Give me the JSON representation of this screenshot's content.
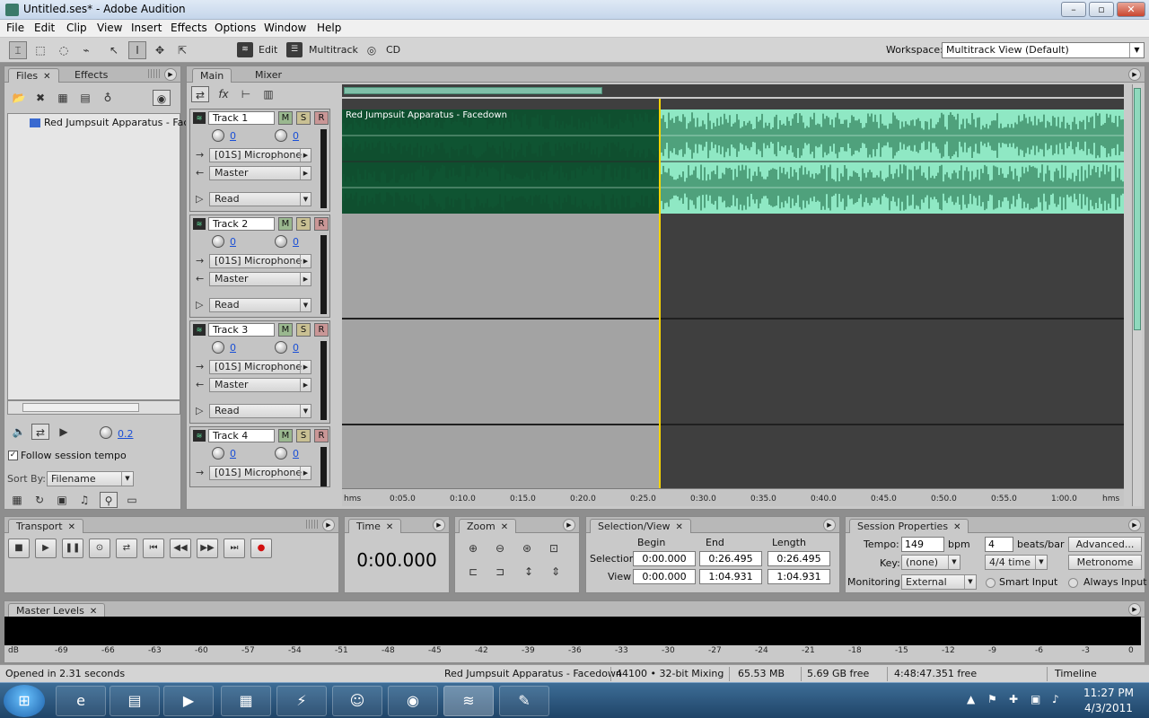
{
  "window": {
    "title": "Untitled.ses* - Adobe Audition",
    "buttons": {
      "minimize": "–",
      "maximize": "▫",
      "close": "✕"
    }
  },
  "menu": [
    "File",
    "Edit",
    "Clip",
    "View",
    "Insert",
    "Effects",
    "Options",
    "Window",
    "Help"
  ],
  "toolbar": {
    "edit_label": "Edit",
    "multitrack_label": "Multitrack",
    "cd_label": "CD",
    "workspace_label": "Workspace:",
    "workspace_value": "Multitrack View (Default)"
  },
  "files_panel": {
    "tabs": [
      "Files",
      "Effects"
    ],
    "items": [
      "Red Jumpsuit Apparatus - Faced"
    ],
    "volume_value": "0.2",
    "follow_tempo_label": "Follow session tempo",
    "sort_by_label": "Sort By:",
    "sort_by_value": "Filename"
  },
  "main_panel": {
    "tabs": [
      "Main",
      "Mixer"
    ],
    "tracks": [
      {
        "name": "Track 1",
        "vol": "0",
        "pan": "0",
        "input": "[01S] Microphone",
        "output": "Master",
        "automation": "Read"
      },
      {
        "name": "Track 2",
        "vol": "0",
        "pan": "0",
        "input": "[01S] Microphone",
        "output": "Master",
        "automation": "Read"
      },
      {
        "name": "Track 3",
        "vol": "0",
        "pan": "0",
        "input": "[01S] Microphone",
        "output": "Master",
        "automation": "Read"
      },
      {
        "name": "Track 4",
        "vol": "0",
        "pan": "0",
        "input": "[01S] Microphone",
        "output": "",
        "automation": ""
      }
    ],
    "msr": [
      "M",
      "S",
      "R"
    ],
    "clip_name": "Red Jumpsuit Apparatus - Facedown",
    "ruler": [
      "hms",
      "0:05.0",
      "0:10.0",
      "0:15.0",
      "0:20.0",
      "0:25.0",
      "0:30.0",
      "0:35.0",
      "0:40.0",
      "0:45.0",
      "0:50.0",
      "0:55.0",
      "1:00.0",
      "hms"
    ]
  },
  "transport": {
    "title": "Transport"
  },
  "time": {
    "title": "Time",
    "display": "0:00.000"
  },
  "zoom": {
    "title": "Zoom"
  },
  "selection_view": {
    "title": "Selection/View",
    "headers": [
      "Begin",
      "End",
      "Length"
    ],
    "selection_label": "Selection",
    "view_label": "View",
    "selection": [
      "0:00.000",
      "0:26.495",
      "0:26.495"
    ],
    "view": [
      "0:00.000",
      "1:04.931",
      "1:04.931"
    ]
  },
  "session": {
    "title": "Session Properties",
    "tempo_label": "Tempo:",
    "tempo": "149",
    "bpm": "bpm",
    "beats": "4",
    "beats_label": "beats/bar",
    "advanced": "Advanced...",
    "key_label": "Key:",
    "key": "(none)",
    "time_sig": "4/4 time",
    "metronome": "Metronome",
    "monitoring_label": "Monitoring:",
    "monitoring": "External",
    "smart_input": "Smart Input",
    "always_input": "Always Input"
  },
  "master_levels": {
    "title": "Master Levels",
    "scale": [
      "dB",
      "-69",
      "-66",
      "-63",
      "-60",
      "-57",
      "-54",
      "-51",
      "-48",
      "-45",
      "-42",
      "-39",
      "-36",
      "-33",
      "-30",
      "-27",
      "-24",
      "-21",
      "-18",
      "-15",
      "-12",
      "-9",
      "-6",
      "-3",
      "0"
    ]
  },
  "status": {
    "opened": "Opened in 2.31 seconds",
    "file": "Red Jumpsuit Apparatus - Facedown",
    "format": "44100 • 32-bit Mixing",
    "size": "65.53 MB",
    "free": "5.69 GB free",
    "time_free": "4:48:47.351 free",
    "view": "Timeline"
  },
  "taskbar": {
    "time": "11:27 PM",
    "date": "4/3/2011"
  },
  "colors": {
    "clip": "#8fe8c4",
    "clip_selected": "#0f4f2f",
    "lane": "#3f3f3f",
    "lane_selected": "#a3a3a3",
    "link": "#1a4fd6"
  }
}
